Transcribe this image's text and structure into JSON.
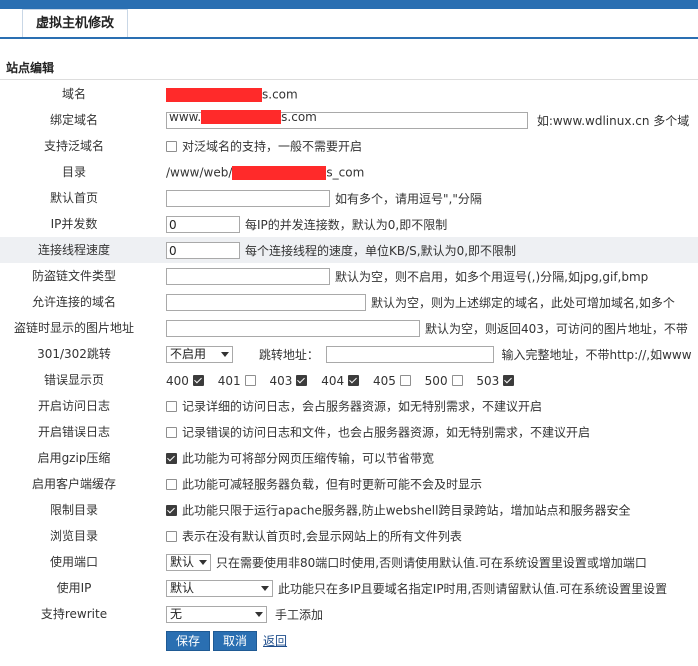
{
  "header": {
    "tab_title": "虚拟主机修改"
  },
  "section_title": "站点编辑",
  "rows": {
    "domain": {
      "label": "域名",
      "suffix": "s.com"
    },
    "bind_domain": {
      "label": "绑定域名",
      "prefix": "www.",
      "suffix": "s.com",
      "hint": "如:www.wdlinux.cn 多个域"
    },
    "wildcard": {
      "label": "支持泛域名",
      "checked": false,
      "text": "对泛域名的支持，一般不需要开启"
    },
    "directory": {
      "label": "目录",
      "prefix": "/www/web/",
      "suffix": "s_com"
    },
    "default_page": {
      "label": "默认首页",
      "value": "",
      "hint": "如有多个，请用逗号\",\"分隔"
    },
    "ip_concurrency": {
      "label": "IP并发数",
      "value": "0",
      "hint": "每IP的并发连接数，默认为0,即不限制"
    },
    "thread_speed": {
      "label": "连接线程速度",
      "value": "0",
      "hint": "每个连接线程的速度，单位KB/S,默认为0,即不限制"
    },
    "hotlink_types": {
      "label": "防盗链文件类型",
      "value": "",
      "hint": "默认为空，则不启用，如多个用逗号(,)分隔,如jpg,gif,bmp"
    },
    "allowed_domains": {
      "label": "允许连接的域名",
      "value": "",
      "hint": "默认为空，则为上述绑定的域名，此处可增加域名,如多个"
    },
    "hotlink_image": {
      "label": "盗链时显示的图片地址",
      "value": "",
      "hint": "默认为空，则返回403，可访问的图片地址，不带"
    },
    "redirect": {
      "label": "301/302跳转",
      "select": "不启用",
      "target_label": "跳转地址：",
      "target_value": "",
      "hint": "输入完整地址，不带http://,如www"
    },
    "error_pages": {
      "label": "错误显示页",
      "codes": [
        {
          "code": "400",
          "checked": true
        },
        {
          "code": "401",
          "checked": false
        },
        {
          "code": "403",
          "checked": true
        },
        {
          "code": "404",
          "checked": true
        },
        {
          "code": "405",
          "checked": false
        },
        {
          "code": "500",
          "checked": false
        },
        {
          "code": "503",
          "checked": true
        }
      ]
    },
    "access_log": {
      "label": "开启访问日志",
      "checked": false,
      "text": "记录详细的访问日志，会占服务器资源，如无特别需求，不建议开启"
    },
    "error_log": {
      "label": "开启错误日志",
      "checked": false,
      "text": "记录错误的访问日志和文件，也会占服务器资源，如无特别需求，不建议开启"
    },
    "gzip": {
      "label": "启用gzip压缩",
      "checked": true,
      "text": "此功能为可将部分网页压缩传输，可以节省带宽"
    },
    "client_cache": {
      "label": "启用客户端缓存",
      "checked": false,
      "text": "此功能可减轻服务器负载，但有时更新可能不会及时显示"
    },
    "restrict_dir": {
      "label": "限制目录",
      "checked": true,
      "text": "此功能只限于运行apache服务器,防止webshell跨目录跨站，增加站点和服务器安全"
    },
    "browse_dir": {
      "label": "浏览目录",
      "checked": false,
      "text": "表示在没有默认首页时,会显示网站上的所有文件列表"
    },
    "port": {
      "label": "使用端口",
      "select": "默认",
      "hint": "只在需要使用非80端口时使用,否则请使用默认值.可在系统设置里设置或增加端口"
    },
    "use_ip": {
      "label": "使用IP",
      "select": "默认",
      "hint": "此功能只在多IP且要域名指定IP时用,否则请留默认值.可在系统设置里设置"
    },
    "rewrite": {
      "label": "支持rewrite",
      "select": "无",
      "hint": "手工添加"
    }
  },
  "actions": {
    "save": "保存",
    "cancel": "取消",
    "back": "返回"
  },
  "colors": {
    "accent": "#2a6fb2",
    "redaction": "#ff2a2a"
  }
}
